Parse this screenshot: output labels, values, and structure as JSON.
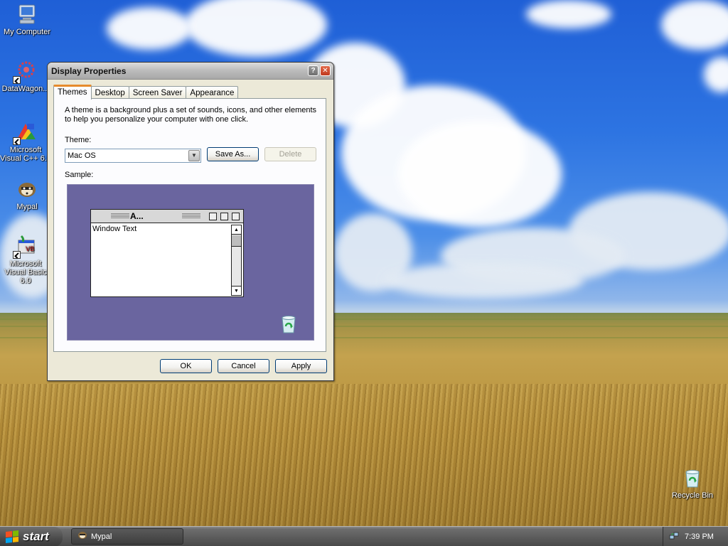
{
  "desktop": {
    "icons": [
      {
        "label": "My Computer"
      },
      {
        "label": "DataWagon..."
      },
      {
        "label": "Microsoft Visual C++ 6.0"
      },
      {
        "label": "Mypal"
      },
      {
        "label": "Microsoft Visual Basic 6.0"
      },
      {
        "label": "Recycle Bin"
      }
    ]
  },
  "window": {
    "title": "Display Properties",
    "help_glyph": "?",
    "close_glyph": "✕",
    "tabs": [
      {
        "label": "Themes",
        "active": true
      },
      {
        "label": "Desktop"
      },
      {
        "label": "Screen Saver"
      },
      {
        "label": "Appearance"
      }
    ],
    "description": "A theme is a background plus a set of sounds, icons, and other elements to help you personalize your computer with one click.",
    "theme_label": "Theme:",
    "theme_value": "Mac OS",
    "save_as_label": "Save As...",
    "delete_label": "Delete",
    "sample_label": "Sample:",
    "sample": {
      "window_title": "A...",
      "window_text": "Window Text"
    },
    "ok_label": "OK",
    "cancel_label": "Cancel",
    "apply_label": "Apply"
  },
  "taskbar": {
    "start_label": "start",
    "tasks": [
      {
        "label": "Mypal"
      }
    ],
    "clock": "7:39 PM"
  },
  "colors": {
    "sample_background": "#6a659f",
    "active_tab_accent": "#e68b2c"
  }
}
